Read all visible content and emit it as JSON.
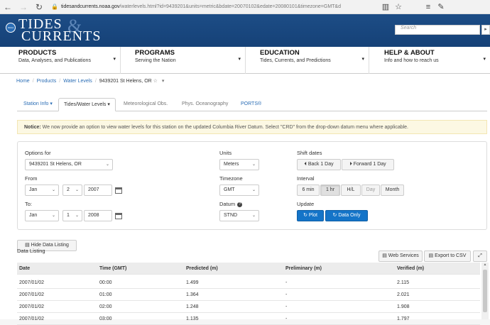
{
  "browser": {
    "back_icon": "←",
    "forward_icon": "→",
    "refresh_icon": "↻",
    "lock_icon": "🔒",
    "url_host": "tidesandcurrents.noaa.gov",
    "url_path": "/waterlevels.html?id=9439201&units=metric&bdate=20070102&edate=20080101&timezone=GMT&d",
    "reading_icon": "▥",
    "favorite_icon": "☆",
    "hub_icon": "≡",
    "notes_icon": "✎"
  },
  "site": {
    "logo_badge": "NOAA",
    "logo_line1": "TIDES",
    "logo_ampersand": "&",
    "logo_line2": "CURRENTS",
    "search_placeholder": "Search",
    "search_icon": "▸"
  },
  "topnav": [
    {
      "title": "PRODUCTS",
      "sub": "Data, Analyses, and Publications",
      "caret": "▾"
    },
    {
      "title": "PROGRAMS",
      "sub": "Serving the Nation",
      "caret": "▾"
    },
    {
      "title": "EDUCATION",
      "sub": "Tides, Currents, and Predictions",
      "caret": "▾"
    },
    {
      "title": "HELP & ABOUT",
      "sub": "Info and how to reach us",
      "caret": "▾"
    }
  ],
  "breadcrumb": {
    "home": "Home",
    "products": "Products",
    "water_levels": "Water Levels",
    "current": "9439201 St Helens, OR",
    "star": "☆",
    "caret": "▾",
    "sep": "/"
  },
  "tabs": [
    {
      "label": "Station Info ▾"
    },
    {
      "label": "Tides/Water Levels ▾"
    },
    {
      "label": "Meteorological Obs."
    },
    {
      "label": "Phys. Oceanography"
    },
    {
      "label": "PORTS®"
    }
  ],
  "notice": {
    "strong": "Notice:",
    "text": " We now provide an option to view water levels for this station on the updated Columbia River Datum. Select \"CRD\" from the drop-down datum menu where applicable."
  },
  "form": {
    "options_for_label": "Options for",
    "station_value": "9439201 St Helens, OR",
    "from_label": "From",
    "from_month": "Jan",
    "from_day": "2",
    "from_year": "2007",
    "to_label": "To:",
    "to_month": "Jan",
    "to_day": "1",
    "to_year": "2008",
    "units_label": "Units",
    "units_value": "Meters",
    "timezone_label": "Timezone",
    "timezone_value": "GMT",
    "datum_label": "Datum",
    "datum_info": "?",
    "datum_value": "STND",
    "shift_label": "Shift dates",
    "back_day": "⏴ Back 1 Day",
    "forward_day": "⏵ Forward 1 Day",
    "interval_label": "Interval",
    "intervals": [
      "6 min",
      "1 hr",
      "H/L",
      "Day",
      "Month"
    ],
    "update_label": "Update",
    "plot_btn": "↻ Plot",
    "data_only_btn": "↻ Data Only",
    "caret": "⌄"
  },
  "listing": {
    "hide_btn": "▤ Hide Data Listing",
    "title": "Data Listing",
    "web_services_btn": "▤ Web Services",
    "export_btn": "▤ Export to CSV",
    "expand_btn": "⤢"
  },
  "table": {
    "headers": [
      "Date",
      "Time (GMT)",
      "Predicted (m)",
      "Preliminary (m)",
      "Verified (m)"
    ],
    "rows": [
      [
        "2007/01/02",
        "00:00",
        "1.499",
        "-",
        "2.115"
      ],
      [
        "2007/01/02",
        "01:00",
        "1.364",
        "-",
        "2.021"
      ],
      [
        "2007/01/02",
        "02:00",
        "1.248",
        "-",
        "1.908"
      ],
      [
        "2007/01/02",
        "03:00",
        "1.135",
        "-",
        "1.797"
      ]
    ]
  }
}
